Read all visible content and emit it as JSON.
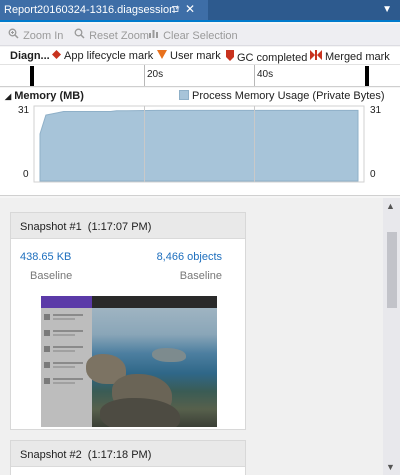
{
  "tab": {
    "title": "Report20160324-1316.diagsession*",
    "pin_glyph": "⊐",
    "close_glyph": "✕",
    "dropdown_glyph": "▼"
  },
  "toolbar": {
    "zoom_in": "Zoom In",
    "reset_zoom": "Reset Zoom",
    "clear_selection": "Clear Selection"
  },
  "legend": {
    "diag_label": "Diagn...",
    "app_lifecycle": "App lifecycle mark",
    "user_mark": "User mark",
    "gc_completed": "GC completed",
    "merged_mark": "Merged mark"
  },
  "ruler": {
    "labels": [
      "20s",
      "40s"
    ]
  },
  "memory": {
    "title": "Memory (MB)",
    "series_label": "Process Memory Usage (Private Bytes)",
    "y_max_left": "31",
    "y_min_left": "0",
    "y_max_right": "31",
    "y_min_right": "0",
    "fill_color": "#a7c4d9"
  },
  "chart_data": {
    "type": "area",
    "x": [
      0,
      1,
      3,
      4,
      5,
      12,
      13,
      20,
      28,
      35,
      40,
      45,
      50,
      54
    ],
    "values": [
      20,
      28,
      29,
      29.5,
      29.5,
      29.5,
      29.8,
      30,
      30,
      30,
      30,
      30,
      30,
      30
    ],
    "ylim": [
      0,
      31
    ],
    "xlim": [
      0,
      54
    ],
    "series": [
      {
        "name": "Process Memory Usage (Private Bytes)",
        "values": [
          20,
          28,
          29,
          29.5,
          29.5,
          29.5,
          29.8,
          30,
          30,
          30,
          30,
          30,
          30,
          30
        ]
      }
    ]
  },
  "snapshots": [
    {
      "title": "Snapshot #1",
      "time": "(1:17:07 PM)",
      "size": "438.65 KB",
      "size_sub": "Baseline",
      "objects": "8,466 objects",
      "objects_sub": "Baseline"
    },
    {
      "title": "Snapshot #2",
      "time": "(1:17:18 PM)"
    }
  ]
}
